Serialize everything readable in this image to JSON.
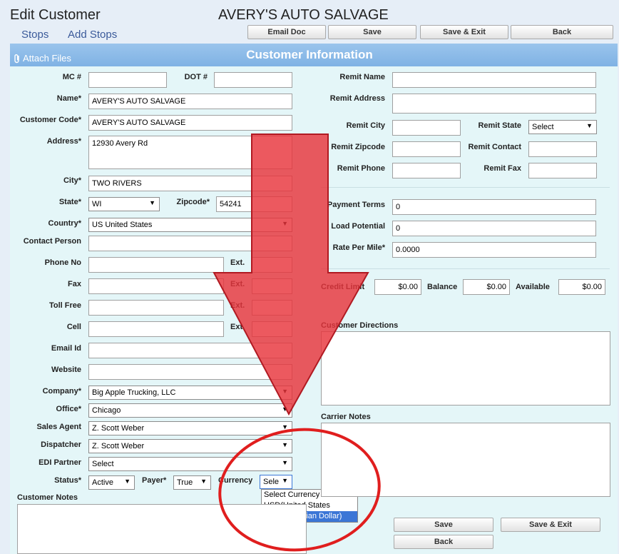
{
  "header": {
    "title": "Edit Customer",
    "company_name": "AVERY'S AUTO SALVAGE",
    "links": {
      "stops": "Stops",
      "add_stops": "Add Stops"
    },
    "buttons": {
      "email_doc": "Email Doc",
      "save": "Save",
      "save_exit": "Save & Exit",
      "back": "Back"
    }
  },
  "section": {
    "title": "Customer Information",
    "attach_files": "Attach Files"
  },
  "left_form": {
    "mc_label": "MC #",
    "mc_value": "",
    "dot_label": "DOT #",
    "dot_value": "",
    "name_label": "Name*",
    "name_value": "AVERY'S AUTO SALVAGE",
    "customer_code_label": "Customer Code*",
    "customer_code_value": "AVERY'S AUTO SALVAGE",
    "address_label": "Address*",
    "address_value": "12930 Avery Rd",
    "city_label": "City*",
    "city_value": "TWO RIVERS",
    "state_label": "State*",
    "state_value": "WI",
    "zipcode_label": "Zipcode*",
    "zipcode_value": "54241",
    "country_label": "Country*",
    "country_value": "US United States",
    "contact_person_label": "Contact Person",
    "phone_label": "Phone No",
    "ext_label": "Ext.",
    "fax_label": "Fax",
    "toll_free_label": "Toll Free",
    "cell_label": "Cell",
    "email_label": "Email Id",
    "website_label": "Website",
    "company_label": "Company*",
    "company_value": "Big Apple Trucking, LLC",
    "office_label": "Office*",
    "office_value": "Chicago",
    "sales_agent_label": "Sales Agent",
    "sales_agent_value": "Z. Scott Weber",
    "dispatcher_label": "Dispatcher",
    "dispatcher_value": "Z. Scott Weber",
    "edi_partner_label": "EDI Partner",
    "edi_partner_value": "Select",
    "status_label": "Status*",
    "status_value": "Active",
    "payer_label": "Payer*",
    "payer_value": "True",
    "currency_label": "Currency",
    "currency_value": "Sele",
    "customer_notes_label": "Customer Notes"
  },
  "currency_options": [
    "Select Currency",
    "USD(United States Dollar)",
    "CAD(Canadian Dollar)"
  ],
  "right_form": {
    "remit_name_label": "Remit Name",
    "remit_address_label": "Remit Address",
    "remit_city_label": "Remit City",
    "remit_state_label": "Remit State",
    "remit_state_value": "Select",
    "remit_zipcode_label": "Remit Zipcode",
    "remit_contact_label": "Remit Contact",
    "remit_phone_label": "Remit Phone",
    "remit_fax_label": "Remit Fax",
    "payment_terms_label": "Payment Terms",
    "payment_terms_value": "0",
    "load_potential_label": "Load Potential",
    "load_potential_value": "0",
    "rate_per_mile_label": "Rate Per Mile*",
    "rate_per_mile_value": "0.0000",
    "credit_limit_label": "Credit Limit",
    "credit_limit_value": "$0.00",
    "balance_label": "Balance",
    "balance_value": "$0.00",
    "available_label": "Available",
    "available_value": "$0.00",
    "customer_directions_label": "Customer Directions",
    "carrier_notes_label": "Carrier Notes"
  },
  "bottom_buttons": {
    "save": "Save",
    "save_exit": "Save &  Exit",
    "back": "Back"
  },
  "annotation": {
    "arrow_color": "#e8343c",
    "circle_color": "#e01e1e"
  }
}
